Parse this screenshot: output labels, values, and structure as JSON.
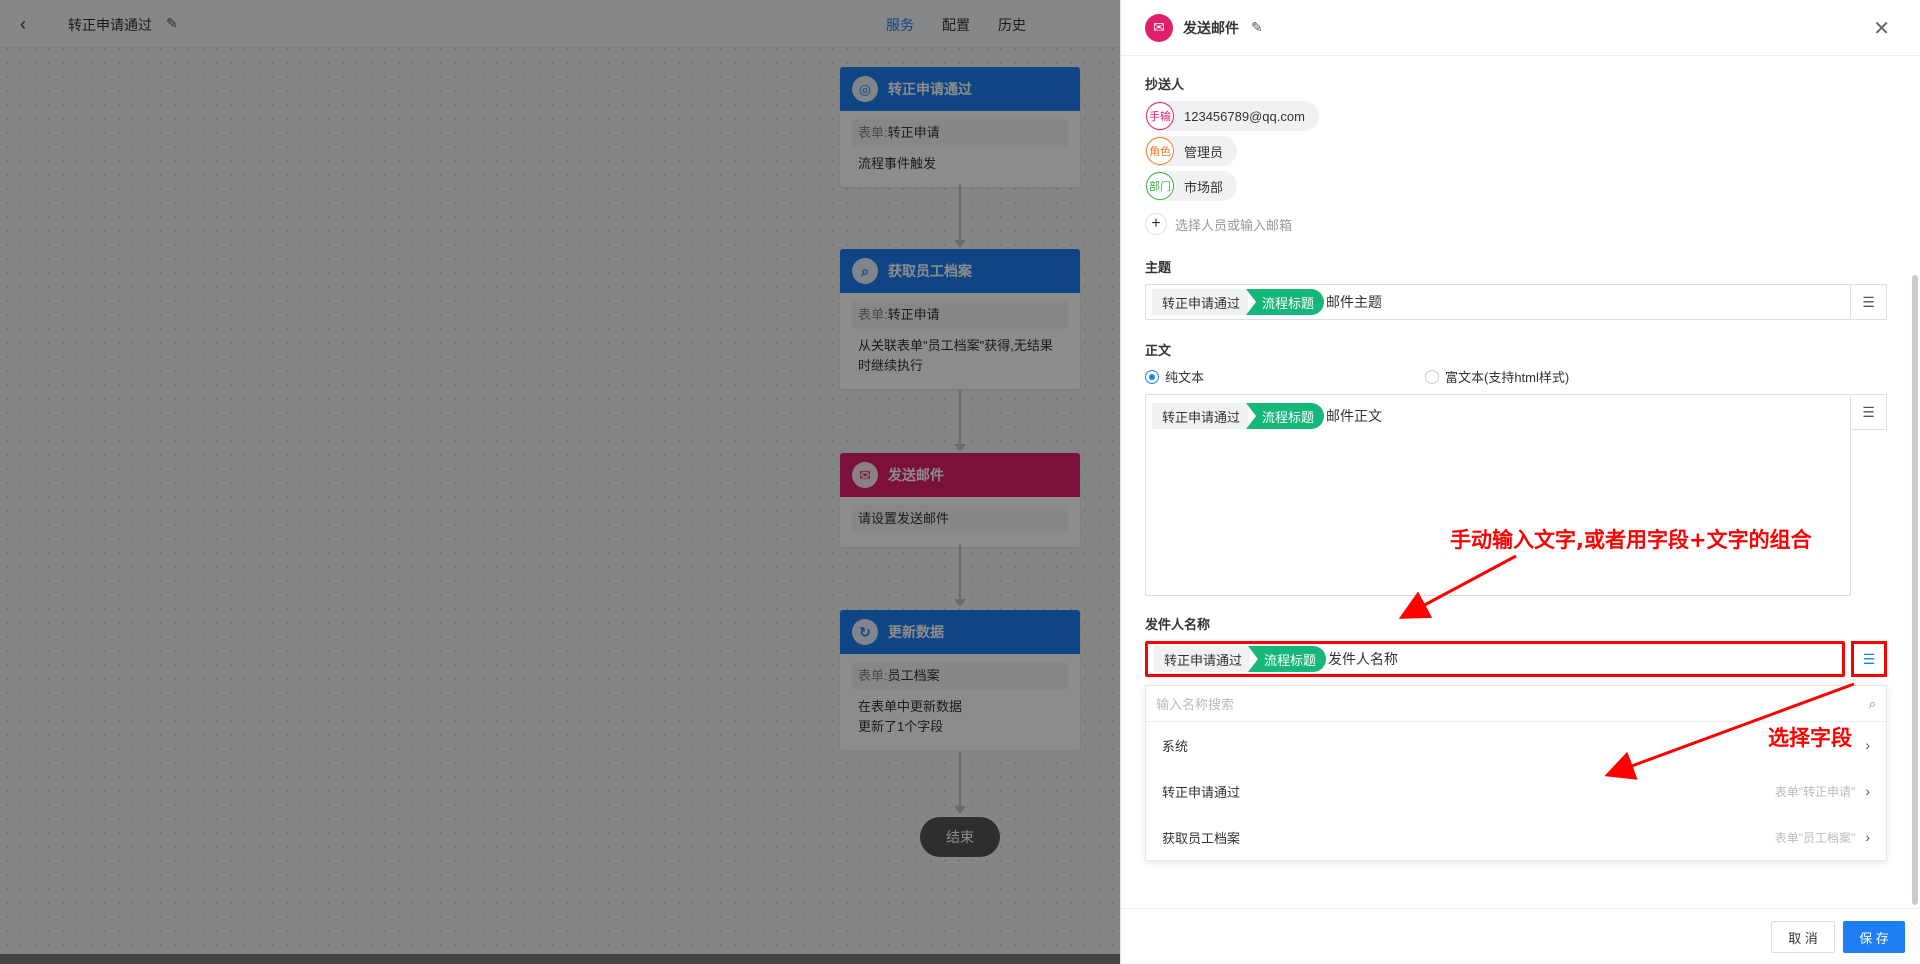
{
  "topbar": {
    "back_icon": "chevron-left-icon",
    "title": "转正申请通过",
    "tabs": [
      {
        "label": "服务",
        "active": true
      },
      {
        "label": "配置",
        "active": false
      },
      {
        "label": "历史",
        "active": false
      }
    ]
  },
  "nodes": [
    {
      "title": "转正申请通过",
      "color": "#1d7ff2",
      "icon": "target-icon",
      "form_label": "表单:",
      "form_value": "转正申请",
      "lines": [
        "流程事件触发"
      ]
    },
    {
      "title": "获取员工档案",
      "color": "#1d7ff2",
      "icon": "search-icon",
      "form_label": "表单:",
      "form_value": "转正申请",
      "lines": [
        "从关联表单\"员工档案\"获得,无结果",
        "时继续执行"
      ]
    },
    {
      "title": "发送邮件",
      "color": "#e0206b",
      "icon": "mail-icon",
      "lines": [
        "请设置发送邮件"
      ]
    },
    {
      "title": "更新数据",
      "color": "#1d7ff2",
      "icon": "refresh-icon",
      "form_label": "表单:",
      "form_value": "员工档案",
      "lines": [
        "在表单中更新数据",
        "更新了1个字段"
      ]
    }
  ],
  "end_label": "结束",
  "panel": {
    "title": "发送邮件",
    "cc_label": "抄送人",
    "cc_items": [
      {
        "badge": "手输",
        "value": "123456789@qq.com",
        "color": "#e0206b"
      },
      {
        "badge": "角色",
        "value": "管理员",
        "color": "#f0781e"
      },
      {
        "badge": "部门",
        "value": "市场部",
        "color": "#3bb24a"
      }
    ],
    "cc_add_placeholder": "选择人员或输入邮箱",
    "subject_label": "主题",
    "subject": {
      "tag_grey": "转正申请通过",
      "tag_green": "流程标题",
      "text": "邮件主题"
    },
    "body_label": "正文",
    "body_radio_plain": "纯文本",
    "body_radio_rich": "富文本(支持html样式)",
    "body": {
      "tag_grey": "转正申请通过",
      "tag_green": "流程标题",
      "text": "邮件正文"
    },
    "sender_label": "发件人名称",
    "sender": {
      "tag_grey": "转正申请通过",
      "tag_green": "流程标题",
      "text": "发件人名称"
    },
    "dropdown": {
      "search_placeholder": "输入名称搜索",
      "items": [
        {
          "label": "系统",
          "hint": ""
        },
        {
          "label": "转正申请通过",
          "hint": "表单\"转正申请\""
        },
        {
          "label": "获取员工档案",
          "hint": "表单\"员工档案\""
        }
      ]
    },
    "cancel_label": "取 消",
    "save_label": "保 存"
  },
  "annotations": {
    "manual_input": "手动输入文字,或者用字段+文字的组合",
    "select_field": "选择字段"
  },
  "colors": {
    "accent": "#1d7ff2",
    "mail": "#e0206b",
    "field_tag": "#15b77a",
    "annotation": "#ff0000"
  }
}
